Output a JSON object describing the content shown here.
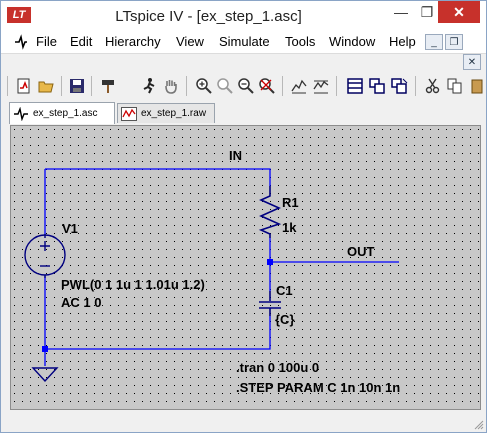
{
  "window": {
    "title": "LTspice IV - [ex_step_1.asc]",
    "app_icon_text": "LT",
    "minimize_glyph": "—",
    "maximize_glyph": "❐",
    "close_glyph": "✕"
  },
  "menubar": {
    "items": [
      "File",
      "Edit",
      "Hierarchy",
      "View",
      "Simulate",
      "Tools",
      "Window",
      "Help"
    ],
    "mdi_minimize": "_",
    "mdi_restore": "❐",
    "mdi_close": "✕"
  },
  "tabs": [
    {
      "label": "ex_step_1.asc",
      "icon": "schematic-icon",
      "active": true
    },
    {
      "label": "ex_step_1.raw",
      "icon": "waveform-icon",
      "active": false
    }
  ],
  "schematic": {
    "net_in": "IN",
    "net_out": "OUT",
    "r1_name": "R1",
    "r1_value": "1k",
    "c1_name": "C1",
    "c1_value": "{C}",
    "v1_name": "V1",
    "v1_value": "PWL(0 1 1u 1 1.01u 1.2)",
    "v1_ac": "AC 1 0",
    "directive_tran": ".tran 0 100u 0",
    "directive_step": ".STEP PARAM C 1n 10n 1n"
  },
  "colors": {
    "wire": "#0000ff",
    "component": "#000080",
    "text": "#000000",
    "canvas_bg": "#c8c8c8",
    "grid_dot": "#000000"
  }
}
